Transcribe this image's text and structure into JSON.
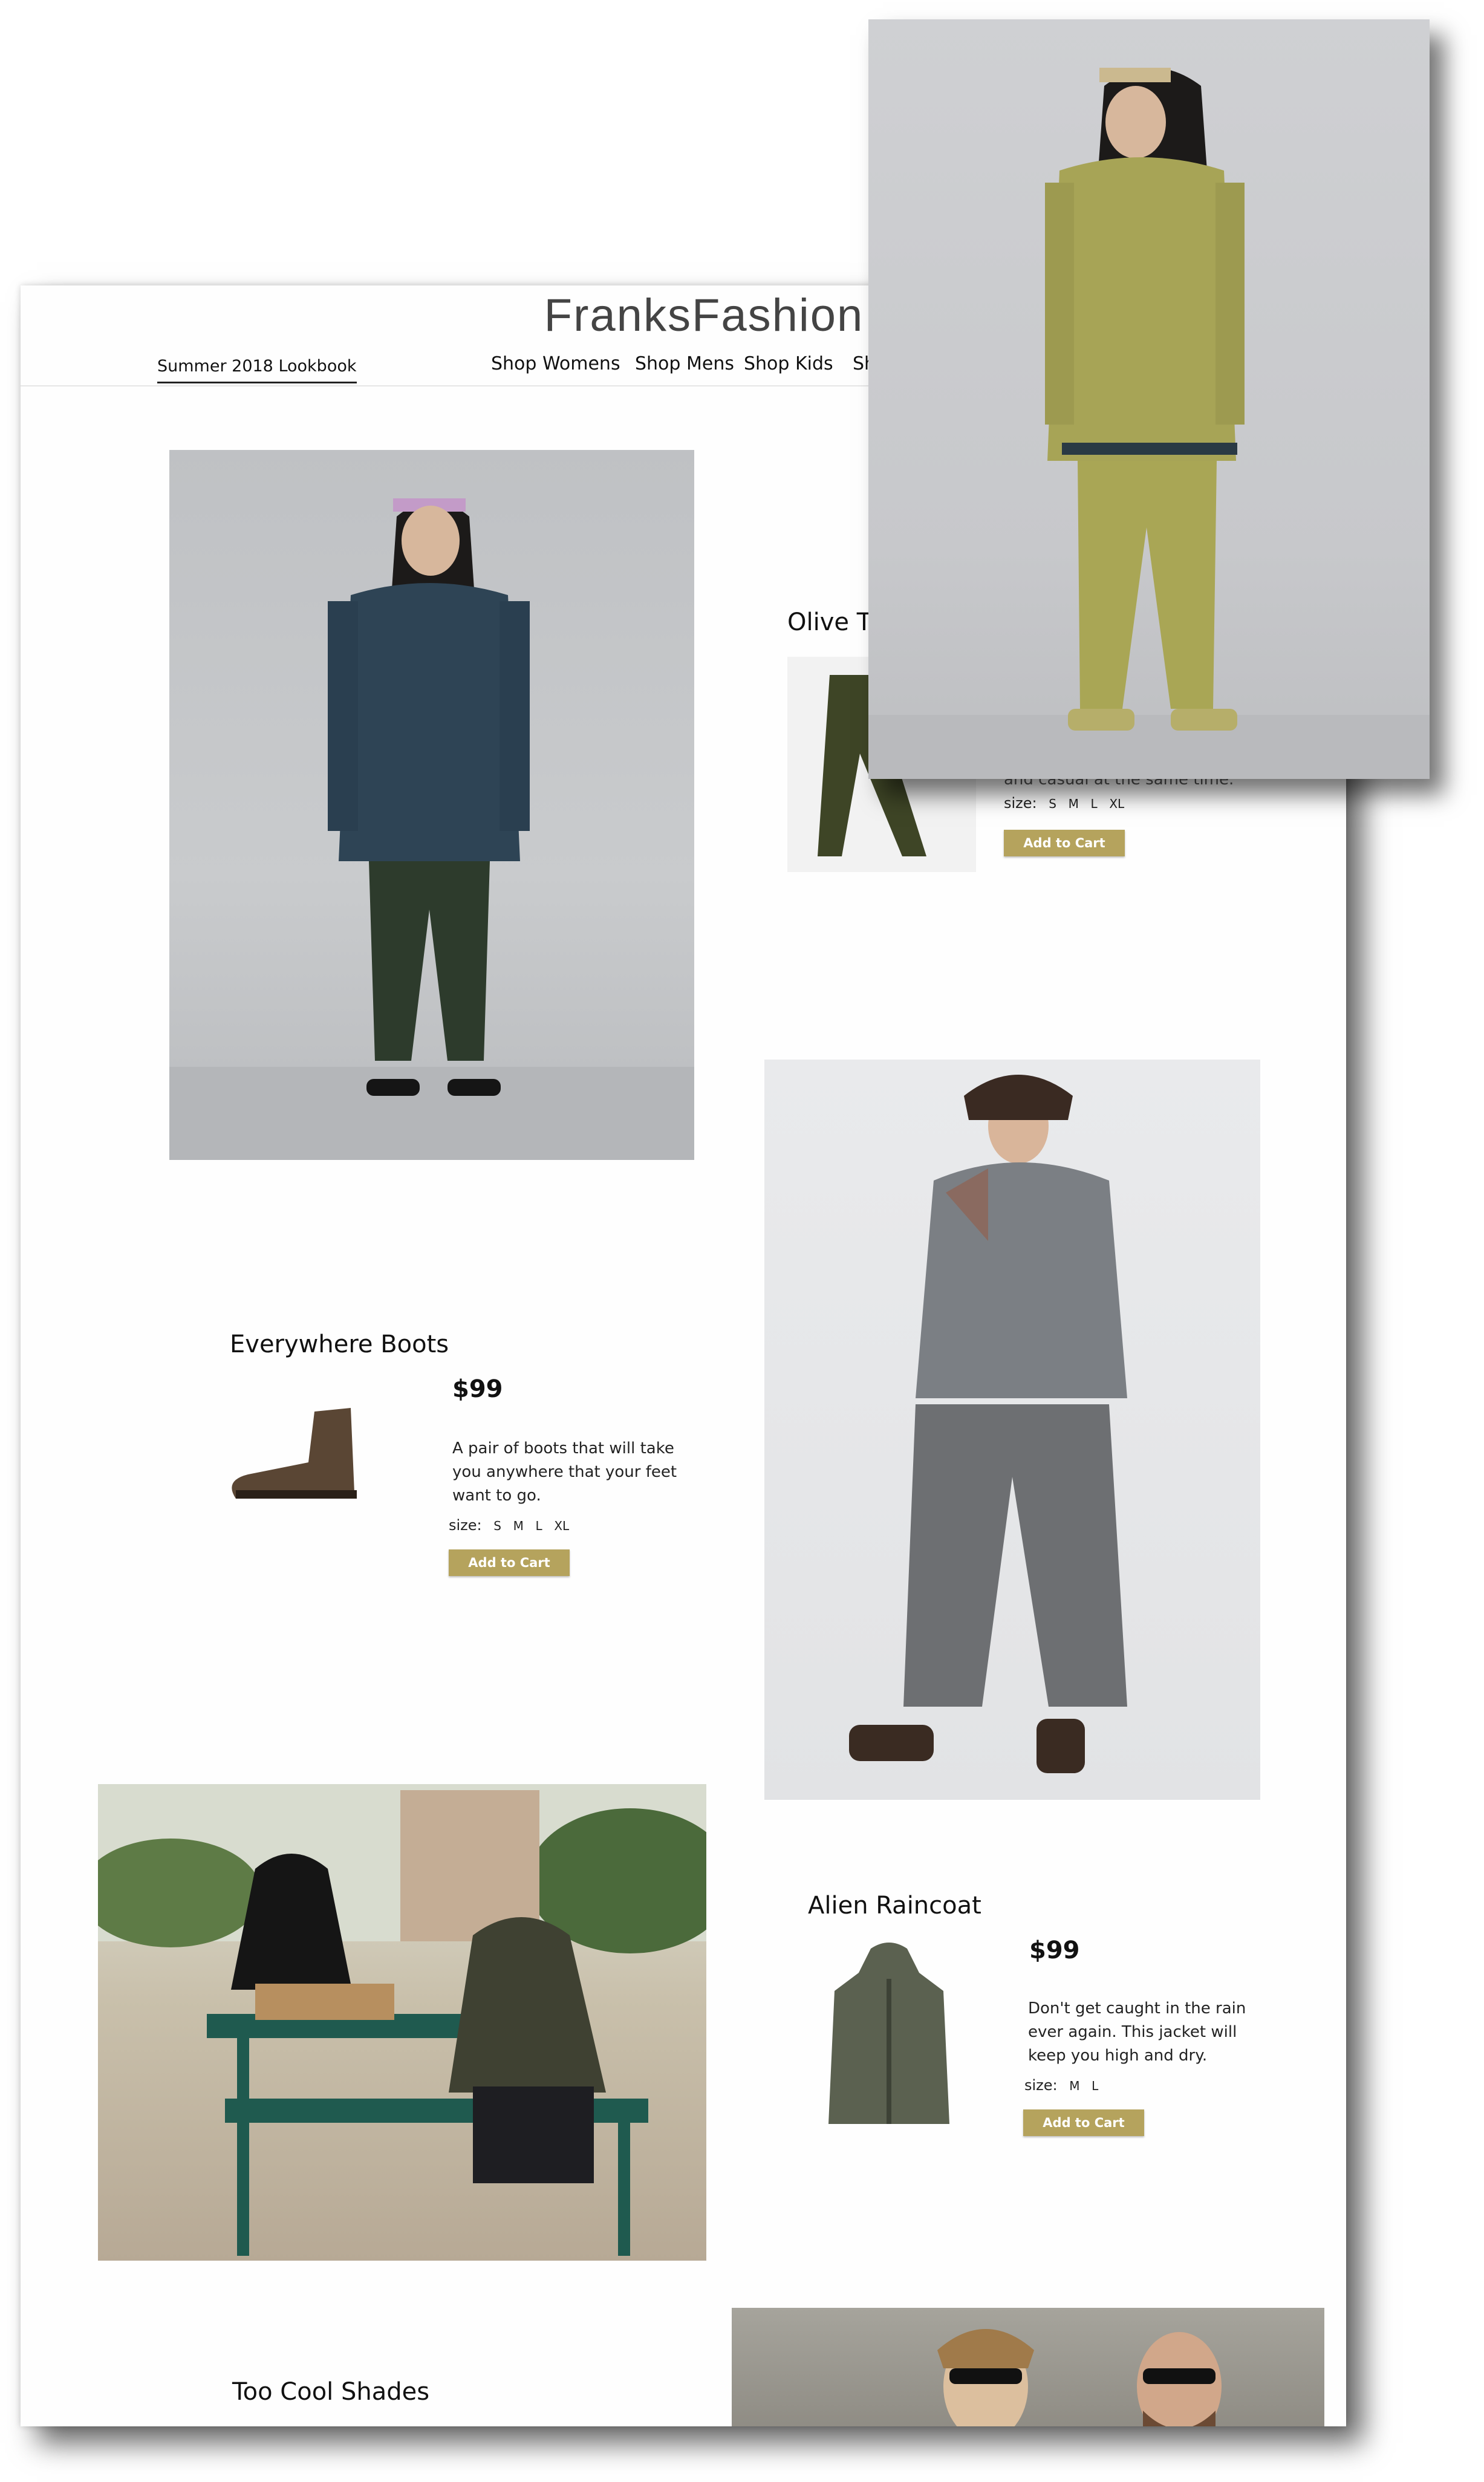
{
  "site": {
    "logo": "FranksFashion"
  },
  "nav": {
    "lookbook": "Summer 2018 Lookbook",
    "items": [
      "Shop Womens",
      "Shop Mens",
      "Shop Kids",
      "Sh"
    ]
  },
  "products": [
    {
      "title": "Olive Tr",
      "desc_visible": "and casual at the same time.",
      "size_label": "size:",
      "sizes": [
        "S",
        "M",
        "L",
        "XL"
      ],
      "button": "Add to Cart"
    },
    {
      "title": "Everywhere Boots",
      "price": "$99",
      "desc": [
        "A pair of boots that will take",
        "you anywhere that your feet",
        "want to go."
      ],
      "size_label": "size:",
      "sizes": [
        "S",
        "M",
        "L",
        "XL"
      ],
      "button": "Add to Cart"
    },
    {
      "title": "Alien Raincoat",
      "price": "$99",
      "desc": [
        "Don't get caught in the rain",
        "ever again. This jacket will",
        "keep you high and dry."
      ],
      "size_label": "size:",
      "sizes": [
        "M",
        "L"
      ],
      "button": "Add to Cart"
    },
    {
      "title": "Too Cool Shades"
    }
  ],
  "colors": {
    "accent": "#b5a35d",
    "text": "#111111",
    "overlay_tint": "#a7a456"
  }
}
